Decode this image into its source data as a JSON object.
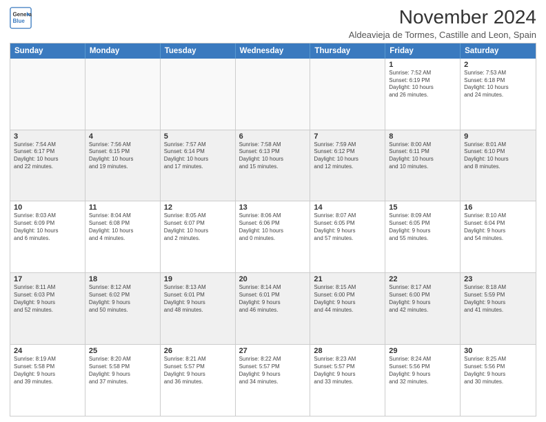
{
  "logo": {
    "line1": "General",
    "line2": "Blue"
  },
  "title": "November 2024",
  "subtitle": "Aldeavieja de Tormes, Castille and Leon, Spain",
  "header_days": [
    "Sunday",
    "Monday",
    "Tuesday",
    "Wednesday",
    "Thursday",
    "Friday",
    "Saturday"
  ],
  "weeks": [
    [
      {
        "day": "",
        "info": "",
        "empty": true
      },
      {
        "day": "",
        "info": "",
        "empty": true
      },
      {
        "day": "",
        "info": "",
        "empty": true
      },
      {
        "day": "",
        "info": "",
        "empty": true
      },
      {
        "day": "",
        "info": "",
        "empty": true
      },
      {
        "day": "1",
        "info": "Sunrise: 7:52 AM\nSunset: 6:19 PM\nDaylight: 10 hours\nand 26 minutes.",
        "empty": false
      },
      {
        "day": "2",
        "info": "Sunrise: 7:53 AM\nSunset: 6:18 PM\nDaylight: 10 hours\nand 24 minutes.",
        "empty": false
      }
    ],
    [
      {
        "day": "3",
        "info": "Sunrise: 7:54 AM\nSunset: 6:17 PM\nDaylight: 10 hours\nand 22 minutes.",
        "empty": false
      },
      {
        "day": "4",
        "info": "Sunrise: 7:56 AM\nSunset: 6:15 PM\nDaylight: 10 hours\nand 19 minutes.",
        "empty": false
      },
      {
        "day": "5",
        "info": "Sunrise: 7:57 AM\nSunset: 6:14 PM\nDaylight: 10 hours\nand 17 minutes.",
        "empty": false
      },
      {
        "day": "6",
        "info": "Sunrise: 7:58 AM\nSunset: 6:13 PM\nDaylight: 10 hours\nand 15 minutes.",
        "empty": false
      },
      {
        "day": "7",
        "info": "Sunrise: 7:59 AM\nSunset: 6:12 PM\nDaylight: 10 hours\nand 12 minutes.",
        "empty": false
      },
      {
        "day": "8",
        "info": "Sunrise: 8:00 AM\nSunset: 6:11 PM\nDaylight: 10 hours\nand 10 minutes.",
        "empty": false
      },
      {
        "day": "9",
        "info": "Sunrise: 8:01 AM\nSunset: 6:10 PM\nDaylight: 10 hours\nand 8 minutes.",
        "empty": false
      }
    ],
    [
      {
        "day": "10",
        "info": "Sunrise: 8:03 AM\nSunset: 6:09 PM\nDaylight: 10 hours\nand 6 minutes.",
        "empty": false
      },
      {
        "day": "11",
        "info": "Sunrise: 8:04 AM\nSunset: 6:08 PM\nDaylight: 10 hours\nand 4 minutes.",
        "empty": false
      },
      {
        "day": "12",
        "info": "Sunrise: 8:05 AM\nSunset: 6:07 PM\nDaylight: 10 hours\nand 2 minutes.",
        "empty": false
      },
      {
        "day": "13",
        "info": "Sunrise: 8:06 AM\nSunset: 6:06 PM\nDaylight: 10 hours\nand 0 minutes.",
        "empty": false
      },
      {
        "day": "14",
        "info": "Sunrise: 8:07 AM\nSunset: 6:05 PM\nDaylight: 9 hours\nand 57 minutes.",
        "empty": false
      },
      {
        "day": "15",
        "info": "Sunrise: 8:09 AM\nSunset: 6:05 PM\nDaylight: 9 hours\nand 55 minutes.",
        "empty": false
      },
      {
        "day": "16",
        "info": "Sunrise: 8:10 AM\nSunset: 6:04 PM\nDaylight: 9 hours\nand 54 minutes.",
        "empty": false
      }
    ],
    [
      {
        "day": "17",
        "info": "Sunrise: 8:11 AM\nSunset: 6:03 PM\nDaylight: 9 hours\nand 52 minutes.",
        "empty": false
      },
      {
        "day": "18",
        "info": "Sunrise: 8:12 AM\nSunset: 6:02 PM\nDaylight: 9 hours\nand 50 minutes.",
        "empty": false
      },
      {
        "day": "19",
        "info": "Sunrise: 8:13 AM\nSunset: 6:01 PM\nDaylight: 9 hours\nand 48 minutes.",
        "empty": false
      },
      {
        "day": "20",
        "info": "Sunrise: 8:14 AM\nSunset: 6:01 PM\nDaylight: 9 hours\nand 46 minutes.",
        "empty": false
      },
      {
        "day": "21",
        "info": "Sunrise: 8:15 AM\nSunset: 6:00 PM\nDaylight: 9 hours\nand 44 minutes.",
        "empty": false
      },
      {
        "day": "22",
        "info": "Sunrise: 8:17 AM\nSunset: 6:00 PM\nDaylight: 9 hours\nand 42 minutes.",
        "empty": false
      },
      {
        "day": "23",
        "info": "Sunrise: 8:18 AM\nSunset: 5:59 PM\nDaylight: 9 hours\nand 41 minutes.",
        "empty": false
      }
    ],
    [
      {
        "day": "24",
        "info": "Sunrise: 8:19 AM\nSunset: 5:58 PM\nDaylight: 9 hours\nand 39 minutes.",
        "empty": false
      },
      {
        "day": "25",
        "info": "Sunrise: 8:20 AM\nSunset: 5:58 PM\nDaylight: 9 hours\nand 37 minutes.",
        "empty": false
      },
      {
        "day": "26",
        "info": "Sunrise: 8:21 AM\nSunset: 5:57 PM\nDaylight: 9 hours\nand 36 minutes.",
        "empty": false
      },
      {
        "day": "27",
        "info": "Sunrise: 8:22 AM\nSunset: 5:57 PM\nDaylight: 9 hours\nand 34 minutes.",
        "empty": false
      },
      {
        "day": "28",
        "info": "Sunrise: 8:23 AM\nSunset: 5:57 PM\nDaylight: 9 hours\nand 33 minutes.",
        "empty": false
      },
      {
        "day": "29",
        "info": "Sunrise: 8:24 AM\nSunset: 5:56 PM\nDaylight: 9 hours\nand 32 minutes.",
        "empty": false
      },
      {
        "day": "30",
        "info": "Sunrise: 8:25 AM\nSunset: 5:56 PM\nDaylight: 9 hours\nand 30 minutes.",
        "empty": false
      }
    ]
  ]
}
